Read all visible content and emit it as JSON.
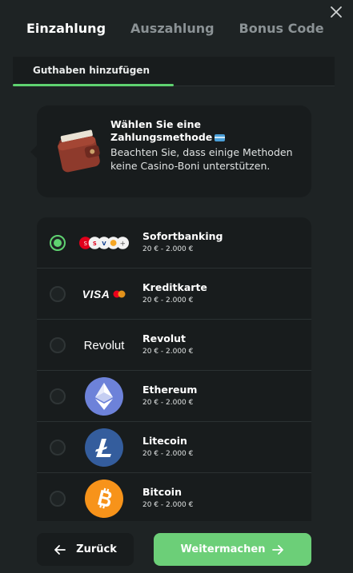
{
  "tabs": [
    {
      "label": "Einzahlung",
      "active": true
    },
    {
      "label": "Auszahlung",
      "active": false
    },
    {
      "label": "Bonus Code",
      "active": false
    }
  ],
  "subtab": {
    "label": "Guthaben hinzufügen"
  },
  "info": {
    "title": "Wählen Sie eine Zahlungsmethode",
    "text": "Beachten Sie, dass einige Methoden keine Casino-Boni unterstützen."
  },
  "methods": [
    {
      "name": "Sofortbanking",
      "range": "20 € - 2.000 €",
      "selected": true,
      "logo": "sofort-icons"
    },
    {
      "name": "Kreditkarte",
      "range": "20 € - 2.000 €",
      "selected": false,
      "logo": "VISA"
    },
    {
      "name": "Revolut",
      "range": "20 € - 2.000 €",
      "selected": false,
      "logo": "Revolut"
    },
    {
      "name": "Ethereum",
      "range": "20 € - 2.000 €",
      "selected": false,
      "logo": "ethereum-icon"
    },
    {
      "name": "Litecoin",
      "range": "20 € - 2.000 €",
      "selected": false,
      "logo": "litecoin-icon"
    },
    {
      "name": "Bitcoin",
      "range": "20 € - 2.000 €",
      "selected": false,
      "logo": "bitcoin-icon"
    }
  ],
  "footer": {
    "back_label": "Zurück",
    "next_label": "Weitermachen"
  },
  "colors": {
    "accent": "#5fd270",
    "button_primary": "#6ccf78",
    "panel": "#181c1d",
    "background": "#1e2324"
  }
}
